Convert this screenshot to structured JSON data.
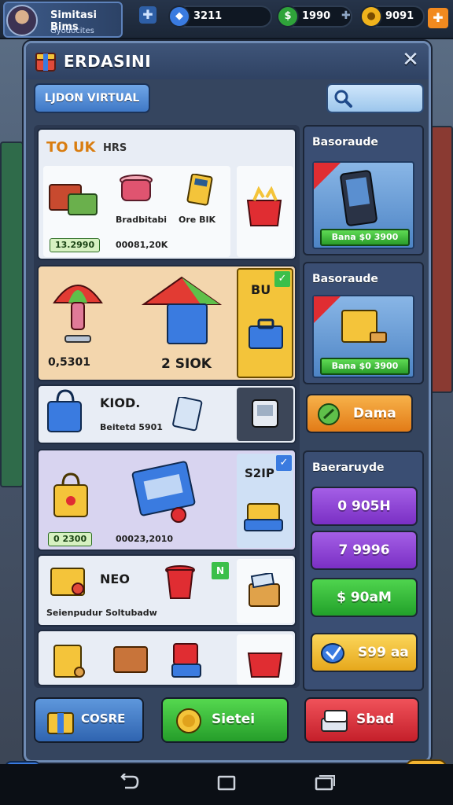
{
  "hud": {
    "player_name": "Simitasi Bims",
    "player_sub": "Gyodocites",
    "plus_symbol": "✚",
    "currencies": [
      {
        "value": "3211",
        "color": "#3a7be0",
        "icon": "gem-icon"
      },
      {
        "value": "1990",
        "color": "#2fa33a",
        "icon": "cash-icon"
      },
      {
        "value": "9091",
        "color": "#f0b31c",
        "icon": "coin-icon"
      }
    ]
  },
  "modal": {
    "title": "ERDASINI",
    "close": "✕",
    "tab_label": "LJDON VIRTUAL",
    "section1": {
      "header_a": "TO UK",
      "header_b": "HRS",
      "items": [
        {
          "name": "Bradbitabi",
          "price": "13.2990"
        },
        {
          "name": "Ore BIK",
          "price": "00081,20K"
        }
      ]
    },
    "section2": {
      "price_a": "0,5301",
      "price_b": "2 SIOK",
      "tag": "BU"
    },
    "section3": {
      "title": "KIOD.",
      "subtitle": "Beitetd 5901"
    },
    "section4": {
      "badge": "S2IP",
      "price_green": "0 2300",
      "price_dark": "00023,2010"
    },
    "section5": {
      "title": "NEO",
      "subtitle": "Seienpudur Soltubadw",
      "badge": "N"
    },
    "right": {
      "card1_title": "Basoraude",
      "card1_price": "Bana $0 3900",
      "card2_title": "Basoraude",
      "card2_price": "Bana $0 3900",
      "card3_title": "Baeraruyde",
      "btn_orange": "Dama",
      "btn_purple1": "0 905H",
      "btn_purple2": "7 9996",
      "btn_green": "$ 90aM",
      "btn_yellow": "S99 aa"
    },
    "bottom": {
      "btn_blue": "COSRE",
      "btn_green": "Sietei",
      "btn_red": "Sbad"
    },
    "colors": {
      "orange_btn": "#f09a2a",
      "purple_btn": "#8a3fd2",
      "green_btn": "#2fbf3a",
      "yellow_btn": "#f3c43a",
      "blue_btn": "#3f78c6",
      "red_btn": "#dd2f38"
    }
  }
}
